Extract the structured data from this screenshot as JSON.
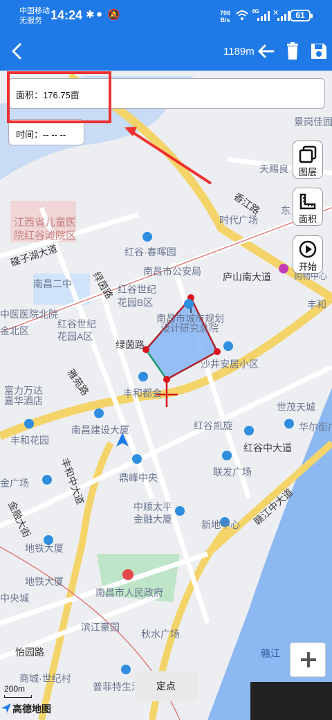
{
  "status_bar": {
    "carrier_line1": "中国移动",
    "carrier_line2": "无服务",
    "time": "14:24",
    "net_speed_value": "706",
    "net_speed_unit": "B/s",
    "network_type": "4G",
    "battery": "61"
  },
  "toolbar": {
    "distance": "1189m"
  },
  "info": {
    "area_label": "面积：",
    "area_value": "176.75亩",
    "time_label": "时间：",
    "time_value": "-- -- --"
  },
  "side_tools": {
    "layers": "图层",
    "area": "面积",
    "start": "开始"
  },
  "map_labels": {
    "jinggang": "景岗佳园",
    "tianci": "天赐良",
    "xiangjiang": "香江路",
    "dong": "东",
    "shidai": "时代广场",
    "hospital1": "江西省儿童医",
    "hospital2": "院红谷滩院区",
    "dieziwu": "碟子湖大道",
    "hongguchunhui": "红谷·春晖园",
    "nanchanger": "南昌二中",
    "lvyin": "绿茵路",
    "nanchanggaj": "南昌市公安局",
    "lushan": "庐山南大道",
    "gouwu": "购物中心",
    "hongguB1": "红谷世纪",
    "hongguB2": "花园B区",
    "guihua1": "南昌市城市规划",
    "guihua2": "设计研究总院",
    "fenghe": "丰和",
    "zhongyiyuan": "中医医院北院",
    "honggua1": "红谷世纪",
    "honggua2": "花园A区",
    "jinqu": "金北区",
    "lvyinlu2": "绿茵路",
    "shajing": "沙井安居小区",
    "yayuan": "雅苑路",
    "fuli1": "富力万达",
    "fuli2": "嘉华酒店",
    "fenghedu": "丰和都会",
    "shimao": "世茂天城",
    "huaer": "华尔街广",
    "jianshe": "南昌建设大厦",
    "fenghehuayuan": "丰和花园",
    "kaixuan": "红谷凯旋",
    "hongguzhong": "红谷中大道",
    "lianfa": "联发广场",
    "jinguangchang": "金广场",
    "fenghezhong": "丰和中大道",
    "dingfeng": "鼎峰中央",
    "ganjiang": "赣江中大道",
    "jinrong": "金融大街",
    "zhongshun1": "中顺太平",
    "zhongshun2": "金融大厦",
    "xindi": "新地中心",
    "ditie": "地铁大厦",
    "ditie2": "地铁大厦",
    "zhengfu": "南昌市人民政府",
    "zhongyang": "中央城",
    "binjiang": "滨江豪园",
    "qiushui": "秋水广场",
    "yigu": "怡园路",
    "shangcheng": "商城·世纪村",
    "pufei": "普菲特生活",
    "ganjiang2": "赣江"
  },
  "controls": {
    "locate": "定点",
    "scale": "200m",
    "logo": "高德地图"
  },
  "colors": {
    "primary": "#1f7ae8",
    "highlight": "#ee3030",
    "polygon_stroke": "#b01e28",
    "polygon_fill": "#7eb2f5"
  }
}
